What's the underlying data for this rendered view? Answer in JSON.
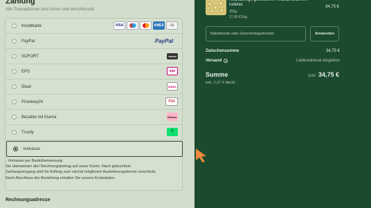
{
  "payment": {
    "title": "Zahlung",
    "subtitle": "Alle Transaktionen sind sicher und verschlüsselt.",
    "methods": [
      {
        "label": "Kreditkarte",
        "logos": [
          "VISA",
          "MC",
          "MC",
          "AMEX",
          "+1"
        ]
      },
      {
        "label": "PayPal",
        "logos": [
          "PayPal"
        ]
      },
      {
        "label": "SOFORT",
        "logos": [
          "sofort"
        ]
      },
      {
        "label": "EPS",
        "logos": [
          "eps"
        ]
      },
      {
        "label": "iDeal",
        "logos": [
          "iDEAL"
        ]
      },
      {
        "label": "Przelewy24",
        "logos": [
          "P24"
        ]
      },
      {
        "label": "Bezahle mit Klarna",
        "logos": [
          "Klarna."
        ]
      },
      {
        "label": "Trustly",
        "logos": [
          "T"
        ]
      },
      {
        "label": "Vorkasse",
        "logos": []
      }
    ],
    "selected_index": 8,
    "info_lines": [
      "- Vorkasse per Banküberweisung",
      "Sie überweisen den Rechnungsbetrag auf unser Konto. Nach gebuchtem",
      "Zahlungseingang wird Ihr Auftrag zum nächst möglichen Auslieferungstermin verschickt.",
      "Nach Abschluss der Bestellung erhalten Sie unsere Kontodaten."
    ],
    "next_section": "Rechnungsadresse"
  },
  "summary": {
    "product": {
      "name": "Ananasringe getrocknet / Ananas seco em rodelas",
      "weight": "250g",
      "unit_price": "27,80 €/1kg",
      "price": "34,75 €"
    },
    "coupon_placeholder": "Rabattcode oder Geschenkgutschein",
    "apply_label": "Anwenden",
    "subtotal_label": "Zwischensumme",
    "subtotal_value": "34,75 €",
    "shipping_label": "Versand",
    "shipping_value": "Lieferadresse eingeben",
    "total_label": "Summe",
    "currency": "EUR",
    "total_value": "34,75 €",
    "tax_note": "inkl. 2,27 € MwSt"
  },
  "colors": {
    "left_bg": "#d3ddcd",
    "right_bg": "#1b4a2f",
    "cursor": "#f08a3a"
  }
}
